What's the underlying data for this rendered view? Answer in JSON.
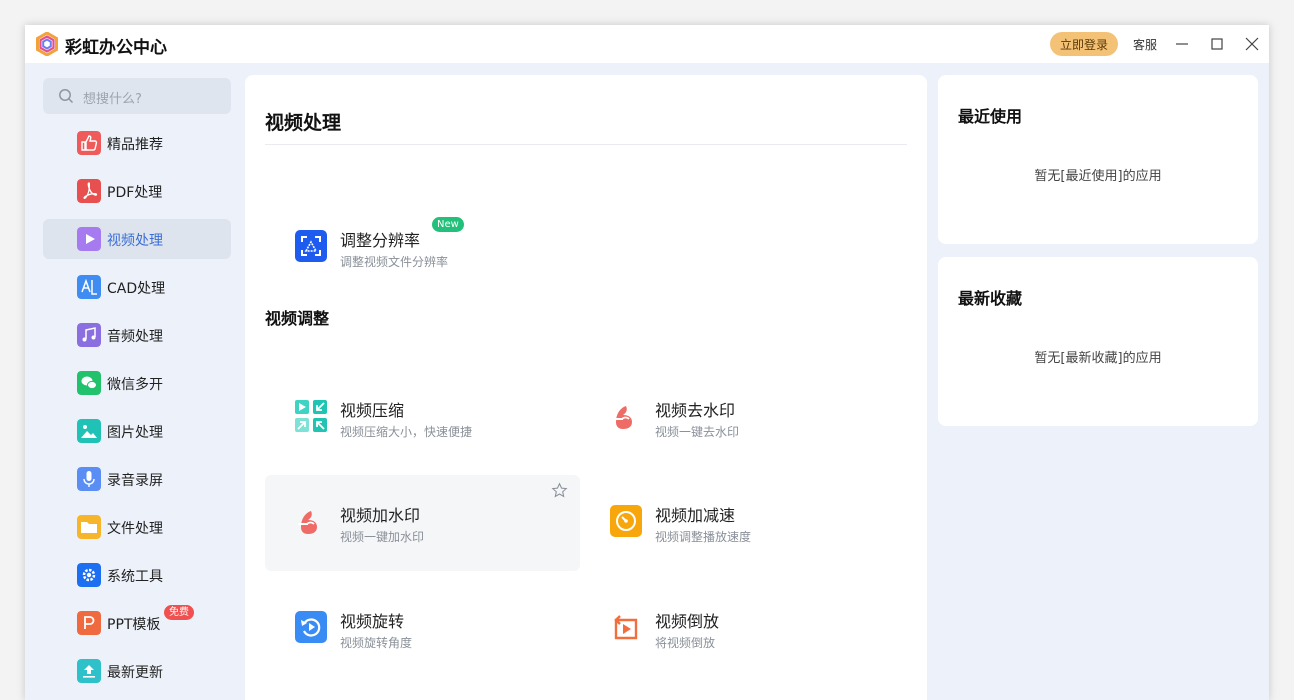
{
  "app": {
    "title": "彩虹办公中心"
  },
  "titlebar": {
    "login_label": "立即登录",
    "service_label": "客服"
  },
  "sidebar": {
    "search_placeholder": "想搜什么?",
    "items": [
      {
        "label": "精品推荐",
        "icon": "thumbs-up-icon",
        "color": "#ef5b5b"
      },
      {
        "label": "PDF处理",
        "icon": "pdf-icon",
        "color": "#e84f4f"
      },
      {
        "label": "视频处理",
        "icon": "play-icon",
        "color": "#a77bf0",
        "active": true
      },
      {
        "label": "CAD处理",
        "icon": "cad-icon",
        "color": "#3f8cf2"
      },
      {
        "label": "音频处理",
        "icon": "music-icon",
        "color": "#8b6fe0"
      },
      {
        "label": "微信多开",
        "icon": "wechat-icon",
        "color": "#22c16b"
      },
      {
        "label": "图片处理",
        "icon": "image-icon",
        "color": "#20c2b5"
      },
      {
        "label": "录音录屏",
        "icon": "microphone-icon",
        "color": "#5b8ef5"
      },
      {
        "label": "文件处理",
        "icon": "folder-icon",
        "color": "#f7b52b"
      },
      {
        "label": "系统工具",
        "icon": "gear-icon",
        "color": "#1c6ff0"
      },
      {
        "label": "PPT模板",
        "icon": "ppt-icon",
        "color": "#f06a3f",
        "badge": "免费"
      },
      {
        "label": "最新更新",
        "icon": "upload-icon",
        "color": "#2ec1c9"
      }
    ]
  },
  "main": {
    "title": "视频处理",
    "featured": {
      "name": "调整分辨率",
      "desc": "调整视频文件分辨率",
      "badge": "New",
      "icon": "resolution-icon"
    },
    "section_title": "视频调整",
    "tools": [
      {
        "name": "视频压缩",
        "desc": "视频压缩大小，快速便捷",
        "icon": "compress-icon"
      },
      {
        "name": "视频去水印",
        "desc": "视频一键去水印",
        "icon": "remove-watermark-icon"
      },
      {
        "name": "视频加水印",
        "desc": "视频一键加水印",
        "icon": "add-watermark-icon"
      },
      {
        "name": "视频加减速",
        "desc": "视频调整播放速度",
        "icon": "speed-icon"
      },
      {
        "name": "视频旋转",
        "desc": "视频旋转角度",
        "icon": "rotate-icon"
      },
      {
        "name": "视频倒放",
        "desc": "将视频倒放",
        "icon": "reverse-icon"
      }
    ]
  },
  "right": {
    "recent_title": "最近使用",
    "recent_empty": "暂无[最近使用]的应用",
    "favorites_title": "最新收藏",
    "favorites_empty": "暂无[最新收藏]的应用"
  }
}
